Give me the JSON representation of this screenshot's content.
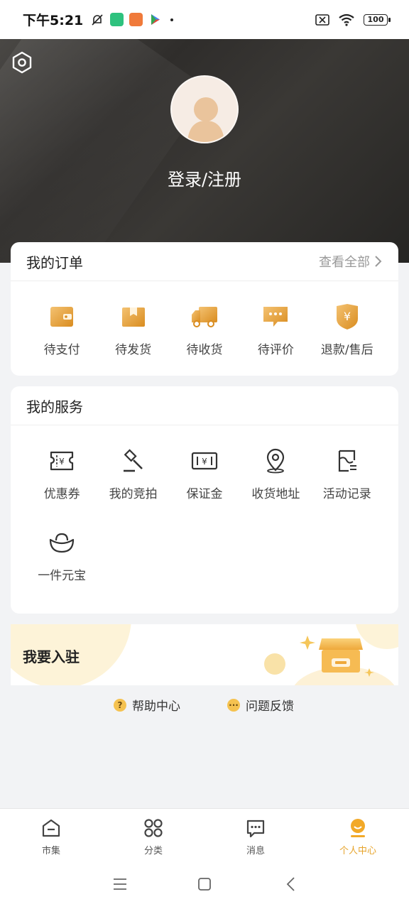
{
  "status_bar": {
    "time": "下午5:21",
    "battery": "100"
  },
  "hero": {
    "login_label": "登录/注册"
  },
  "orders": {
    "title": "我的订单",
    "view_all": "查看全部",
    "items": [
      {
        "label": "待支付",
        "icon": "wallet-icon"
      },
      {
        "label": "待发货",
        "icon": "box-icon"
      },
      {
        "label": "待收货",
        "icon": "truck-icon"
      },
      {
        "label": "待评价",
        "icon": "comment-icon"
      },
      {
        "label": "退款/售后",
        "icon": "yuan-shield-icon"
      }
    ]
  },
  "services": {
    "title": "我的服务",
    "items": [
      {
        "label": "优惠券",
        "icon": "coupon-icon"
      },
      {
        "label": "我的竞拍",
        "icon": "gavel-icon"
      },
      {
        "label": "保证金",
        "icon": "deposit-icon"
      },
      {
        "label": "收货地址",
        "icon": "location-pin-icon"
      },
      {
        "label": "活动记录",
        "icon": "activity-record-icon"
      },
      {
        "label": "一件元宝",
        "icon": "ingot-icon"
      }
    ]
  },
  "banner": {
    "label": "我要入驻"
  },
  "help": {
    "help_center": "帮助中心",
    "feedback": "问题反馈"
  },
  "tabbar": {
    "items": [
      {
        "label": "市集",
        "icon": "market-icon",
        "active": false
      },
      {
        "label": "分类",
        "icon": "category-icon",
        "active": false
      },
      {
        "label": "消息",
        "icon": "message-icon",
        "active": false
      },
      {
        "label": "个人中心",
        "icon": "profile-icon",
        "active": true
      }
    ]
  },
  "colors": {
    "accent": "#e7a42b",
    "icon_gold": "#e9a43a",
    "hero_dark": "#2f2d2b"
  }
}
